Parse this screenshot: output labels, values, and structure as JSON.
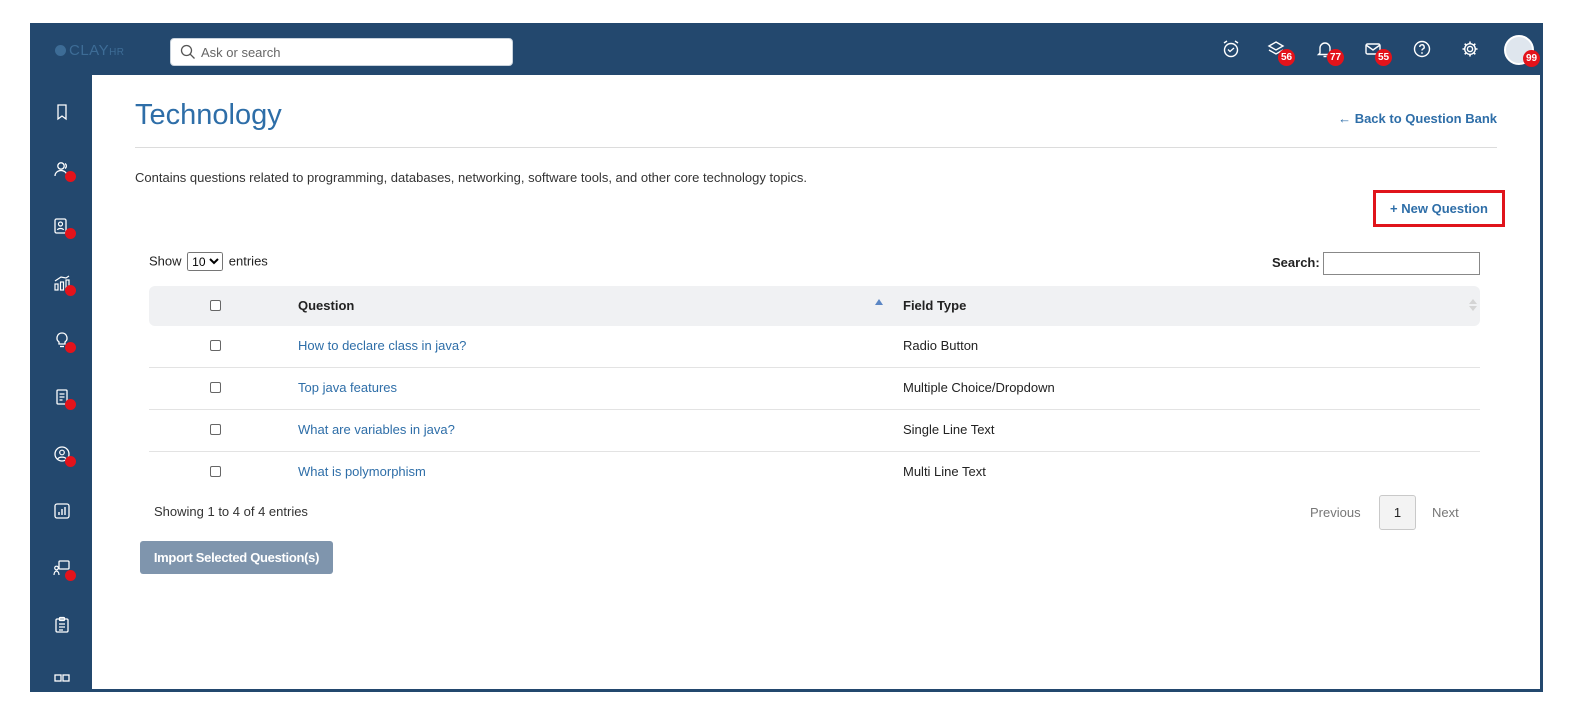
{
  "app": {
    "logo_text": "CLAY",
    "logo_suffix": "HR"
  },
  "search": {
    "placeholder": "Ask or search"
  },
  "topbar": {
    "badges": {
      "layers": "56",
      "notifications": "77",
      "messages": "55",
      "avatar": "99"
    }
  },
  "page": {
    "title": "Technology",
    "back_link": "← Back to Question Bank",
    "description": "Contains questions related to programming, databases, networking, software tools, and other core technology topics.",
    "new_question": "+ New Question"
  },
  "table_controls": {
    "show_label": "Show",
    "entries_label": "entries",
    "page_size": "10",
    "search_label": "Search:"
  },
  "table": {
    "headers": {
      "question": "Question",
      "field_type": "Field Type"
    },
    "rows": [
      {
        "question": "How to declare class in java?",
        "field_type": "Radio Button"
      },
      {
        "question": "Top java features",
        "field_type": "Multiple Choice/Dropdown"
      },
      {
        "question": "What are variables in java?",
        "field_type": "Single Line Text"
      },
      {
        "question": "What is polymorphism",
        "field_type": "Multi Line Text"
      }
    ]
  },
  "pagination": {
    "info": "Showing 1 to 4 of 4 entries",
    "previous": "Previous",
    "current": "1",
    "next": "Next"
  },
  "actions": {
    "import": "Import Selected Question(s)"
  },
  "colors": {
    "brand": "#23486e",
    "link": "#2e6ea8",
    "badge": "#e3131b",
    "highlight_border": "#e0141b"
  }
}
